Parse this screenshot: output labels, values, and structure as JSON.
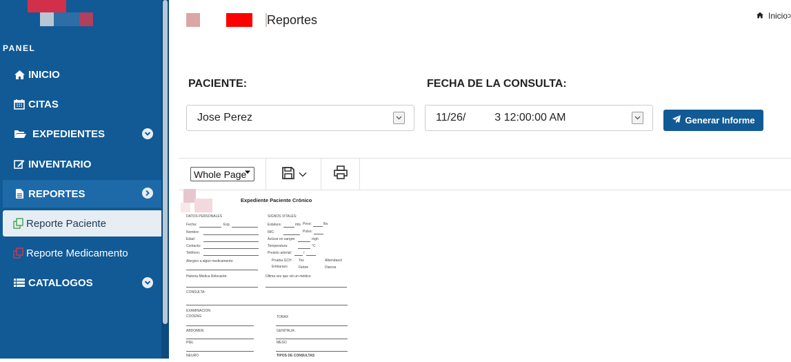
{
  "sidebar": {
    "panel_title": "PANEL",
    "items": [
      {
        "label": "INICIO",
        "icon": "home-icon"
      },
      {
        "label": "CITAS",
        "icon": "calendar-icon"
      },
      {
        "label": "EXPEDIENTES",
        "icon": "folder-open-icon"
      },
      {
        "label": "INVENTARIO",
        "icon": "edit-icon"
      },
      {
        "label": "REPORTES",
        "icon": "file-icon"
      },
      {
        "label": "Reporte Paciente",
        "icon": "copy-icon"
      },
      {
        "label": "Reporte Medicamento",
        "icon": "copy-icon"
      },
      {
        "label": "CATALOGOS",
        "icon": "list-icon"
      }
    ]
  },
  "header": {
    "title": "Reportes",
    "breadcrumb": "Inicio>"
  },
  "form": {
    "paciente_label": "PACIENTE:",
    "paciente_value": "Jose Perez",
    "fecha_label": "FECHA DE LA CONSULTA:",
    "fecha_value_start": "11/26/",
    "fecha_value_end": "3 12:00:00 AM",
    "generate_button": "Generar Informe"
  },
  "viewer": {
    "zoom": "Whole Page"
  },
  "document": {
    "title": "Expediente Paciente Crónico",
    "datos_personales": "DATOS PERSONALES",
    "signos_vitales": "SIGNOS VITALES:",
    "fecha": "Fecha:",
    "exp": "Exp.",
    "nombre": "Nombre:",
    "edad": "Edad:",
    "contacto": "Contacto:",
    "telefono": "Teléfono:",
    "alergico": "Alergico a algún medicamento:",
    "estatura": "Estatura:",
    "mts": "mts",
    "peso": "Peso:",
    "lbs": "lbs",
    "imc": "IMC:",
    "pulso": "Pulso:",
    "azucar": "Azúcar en sangre:",
    "mgh": "mgh",
    "temperatura": "Temperatura:",
    "grados": "°C",
    "presion": "Presión arterial:",
    "slash": "/",
    "prueba_gch": "Prueba GCH",
    "tos": "Tos",
    "albendazol": "Albendazol",
    "embarazo": "Embarazo",
    "fiebre": "Fiebre",
    "diarrea": "Diarrea",
    "historia": "Historia Médica Relevante:",
    "ultima_vez": "Última vez que vió un médico:",
    "consulta": "CONSULTA:",
    "examinacion": "EXAMINACION",
    "cooeng": "COOENG",
    "torax": "TORAX",
    "abdomen": "ABDOMEN",
    "genitalia": "GENITALIA",
    "piel": "PIEL",
    "meso": "MESO",
    "neuro": "NEURO",
    "tipos_consultas": "TIPOS DE CONSULTAS"
  }
}
